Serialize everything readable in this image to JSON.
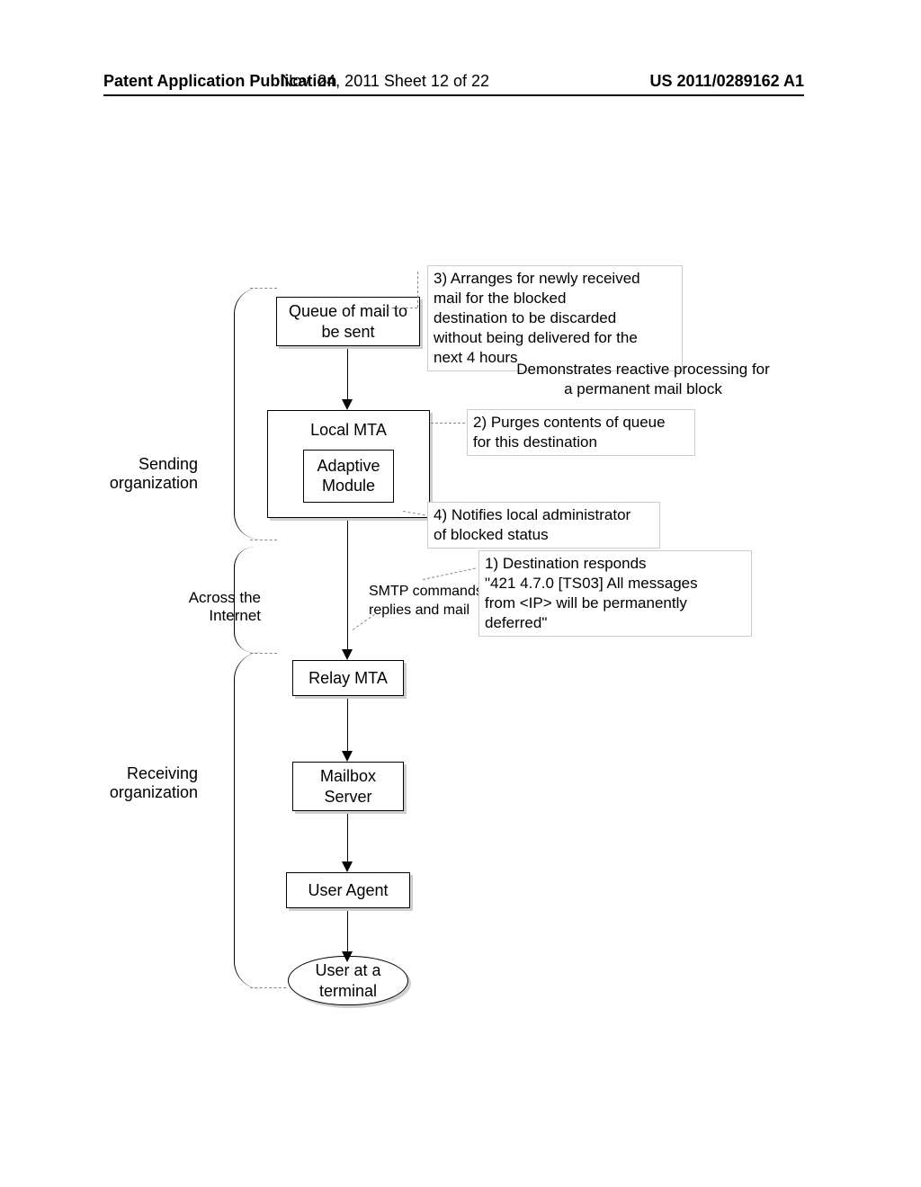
{
  "header": {
    "left": "Patent Application Publication",
    "mid": "Nov. 24, 2011  Sheet 12 of 22",
    "right": "US 2011/0289162 A1"
  },
  "groups": {
    "sending": "Sending\norganization",
    "across": "Across the\nInternet",
    "receiving": "Receiving\norganization"
  },
  "boxes": {
    "queue": "Queue of mail to\nbe sent",
    "localmta": "Local MTA",
    "adaptive": "Adaptive\nModule",
    "relay": "Relay MTA",
    "mailbox": "Mailbox\nServer",
    "agent": "User  Agent",
    "user": "User at a\nterminal"
  },
  "edge": {
    "smtp": "SMTP commands\nreplies and mail"
  },
  "callouts": {
    "c3": "3) Arranges for newly received\nmail for the blocked\ndestination to be discarded\nwithout being delivered for the\nnext 4 hours",
    "c2": "2) Purges contents of queue\nfor this destination",
    "c4": "4) Notifies local administrator\nof blocked status",
    "c1": "1) Destination responds\n\"421 4.7.0 [TS03] All messages\nfrom <IP> will be permanently\ndeferred\""
  },
  "caption": "Demonstrates reactive processing for\na permanent mail block"
}
